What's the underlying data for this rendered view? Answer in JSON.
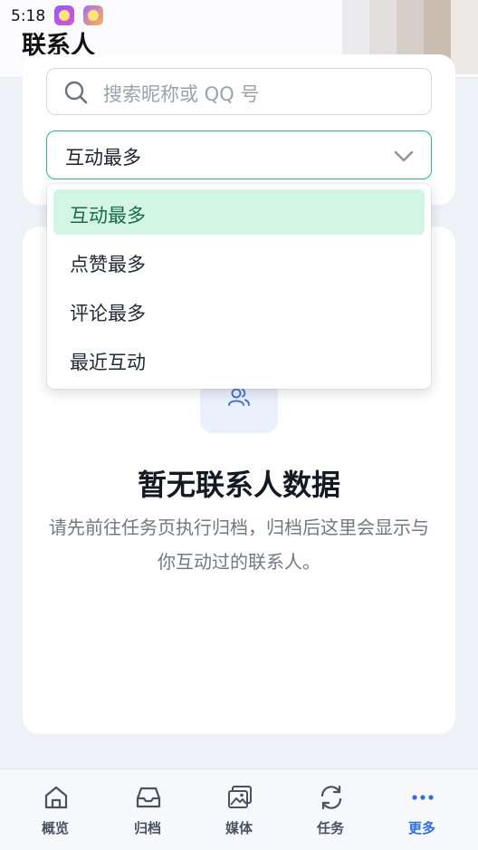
{
  "status_bar": {
    "time": "5:18"
  },
  "header": {
    "title": "联系人"
  },
  "search": {
    "placeholder": "搜索昵称或 QQ 号"
  },
  "sort_select": {
    "value": "互动最多",
    "options": [
      "互动最多",
      "点赞最多",
      "评论最多",
      "最近互动"
    ],
    "selected_index": 0
  },
  "empty_state": {
    "icon": "users-icon",
    "title": "暂无联系人数据",
    "description": "请先前往任务页执行归档，归档后这里会显示与你互动过的联系人。"
  },
  "bottom_nav": {
    "items": [
      {
        "label": "概览",
        "icon": "home-icon"
      },
      {
        "label": "归档",
        "icon": "inbox-icon"
      },
      {
        "label": "媒体",
        "icon": "image-icon"
      },
      {
        "label": "任务",
        "icon": "refresh-icon"
      },
      {
        "label": "更多",
        "icon": "more-icon"
      }
    ],
    "active_index": 4
  },
  "colors": {
    "accent_green": "#2fb37d",
    "selected_option_bg": "#d2f6e3",
    "nav_active": "#2f6fe0"
  }
}
